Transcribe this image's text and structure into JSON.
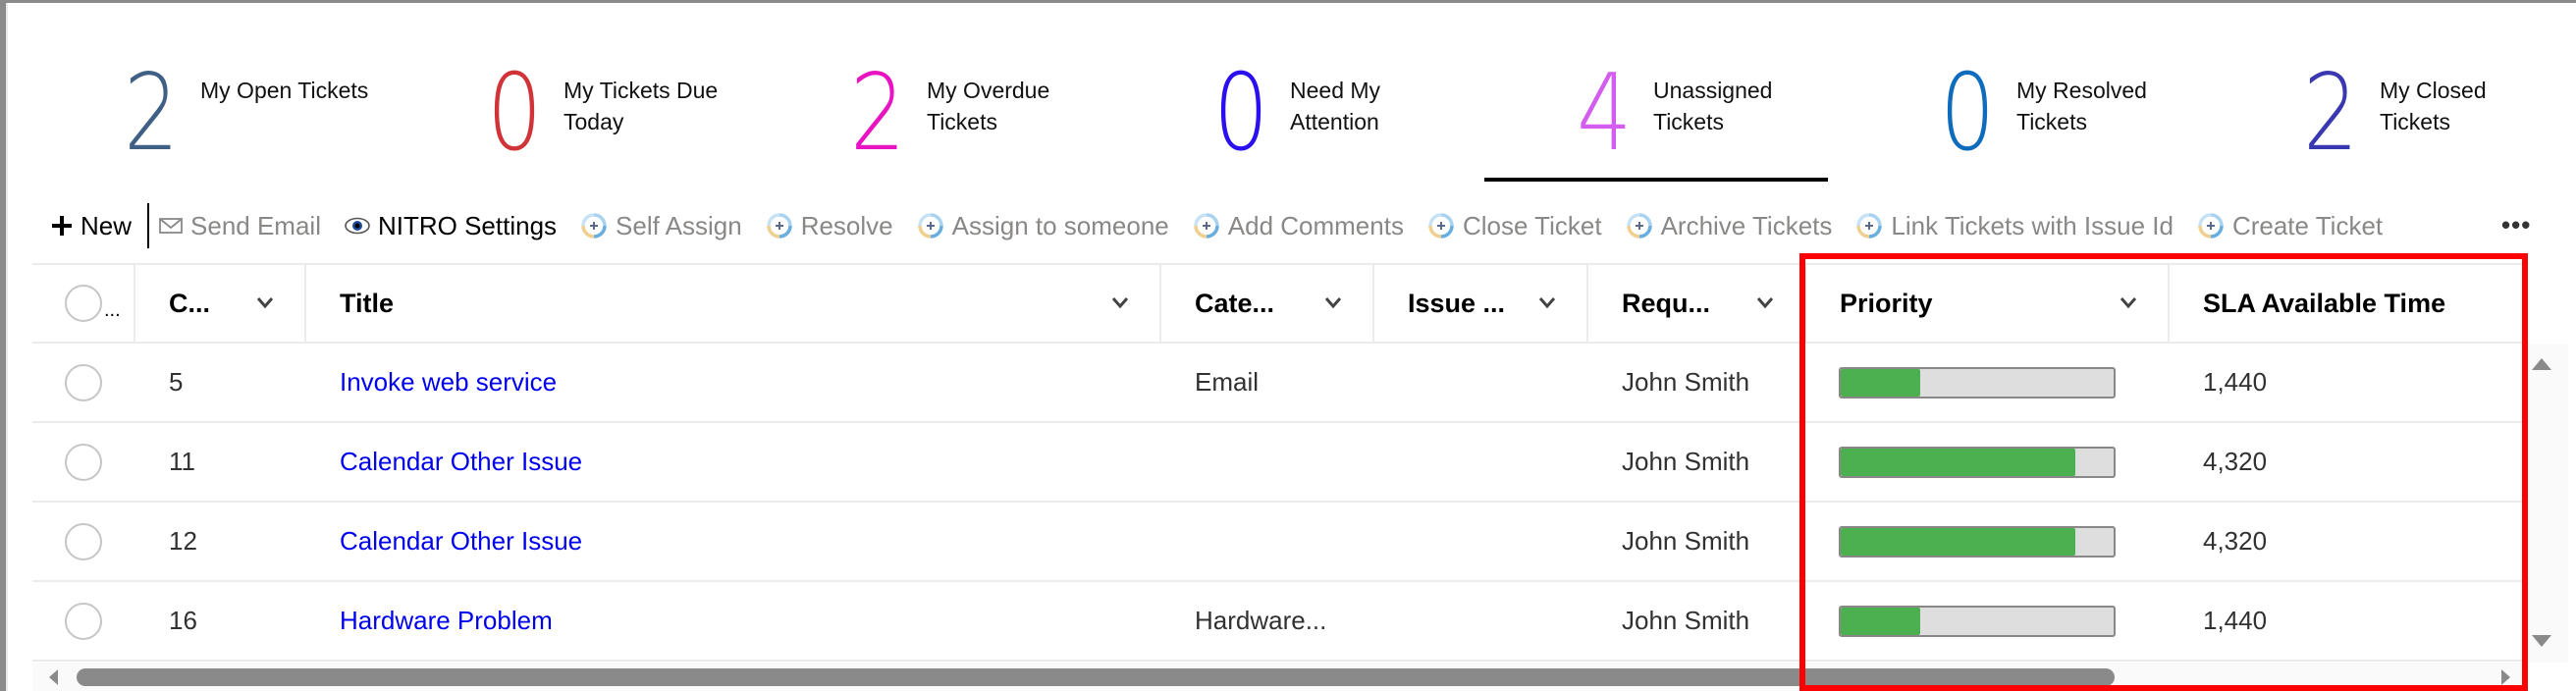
{
  "stats": [
    {
      "count": "2",
      "label": "My Open Tickets",
      "color": "#3f5f85"
    },
    {
      "count": "0",
      "label": "My Tickets Due Today",
      "color": "#d13438"
    },
    {
      "count": "2",
      "label": "My Overdue Tickets",
      "color": "#e813c1"
    },
    {
      "count": "0",
      "label": "Need My Attention",
      "color": "#2a0ff0"
    },
    {
      "count": "4",
      "label": "Unassigned Tickets",
      "color": "#d35df0",
      "active": true
    },
    {
      "count": "0",
      "label": "My Resolved Tickets",
      "color": "#0f6cbd"
    },
    {
      "count": "2",
      "label": "My Closed Tickets",
      "color": "#3a38b0"
    }
  ],
  "toolbar": {
    "new_label": "New",
    "send_email_label": "Send Email",
    "nitro_settings_label": "NITRO Settings",
    "actions": [
      "Self Assign",
      "Resolve",
      "Assign to someone",
      "Add Comments",
      "Close Ticket",
      "Archive Tickets",
      "Link Tickets with Issue Id",
      "Create Ticket"
    ],
    "more_label": "•••"
  },
  "grid": {
    "select_all_ellipsis": "...",
    "columns": {
      "id": "C...",
      "title": "Title",
      "category": "Cate...",
      "issue": "Issue ...",
      "requester": "Requ...",
      "priority": "Priority",
      "sla": "SLA Available Time"
    },
    "rows": [
      {
        "id": "5",
        "title": "Invoke web service",
        "category": "Email",
        "issue": "",
        "requester": "John Smith",
        "priority_fraction": 0.29,
        "sla": "1,440"
      },
      {
        "id": "11",
        "title": "Calendar Other Issue",
        "category": "",
        "issue": "",
        "requester": "John Smith",
        "priority_fraction": 0.86,
        "sla": "4,320"
      },
      {
        "id": "12",
        "title": "Calendar Other Issue",
        "category": "",
        "issue": "",
        "requester": "John Smith",
        "priority_fraction": 0.86,
        "sla": "4,320"
      },
      {
        "id": "16",
        "title": "Hardware Problem",
        "category": "Hardware...",
        "issue": "",
        "requester": "John Smith",
        "priority_fraction": 0.29,
        "sla": "1,440"
      }
    ]
  },
  "colors": {
    "priority_fill": "#4caf50",
    "link": "#0000ee",
    "highlight": "#ff0000"
  }
}
